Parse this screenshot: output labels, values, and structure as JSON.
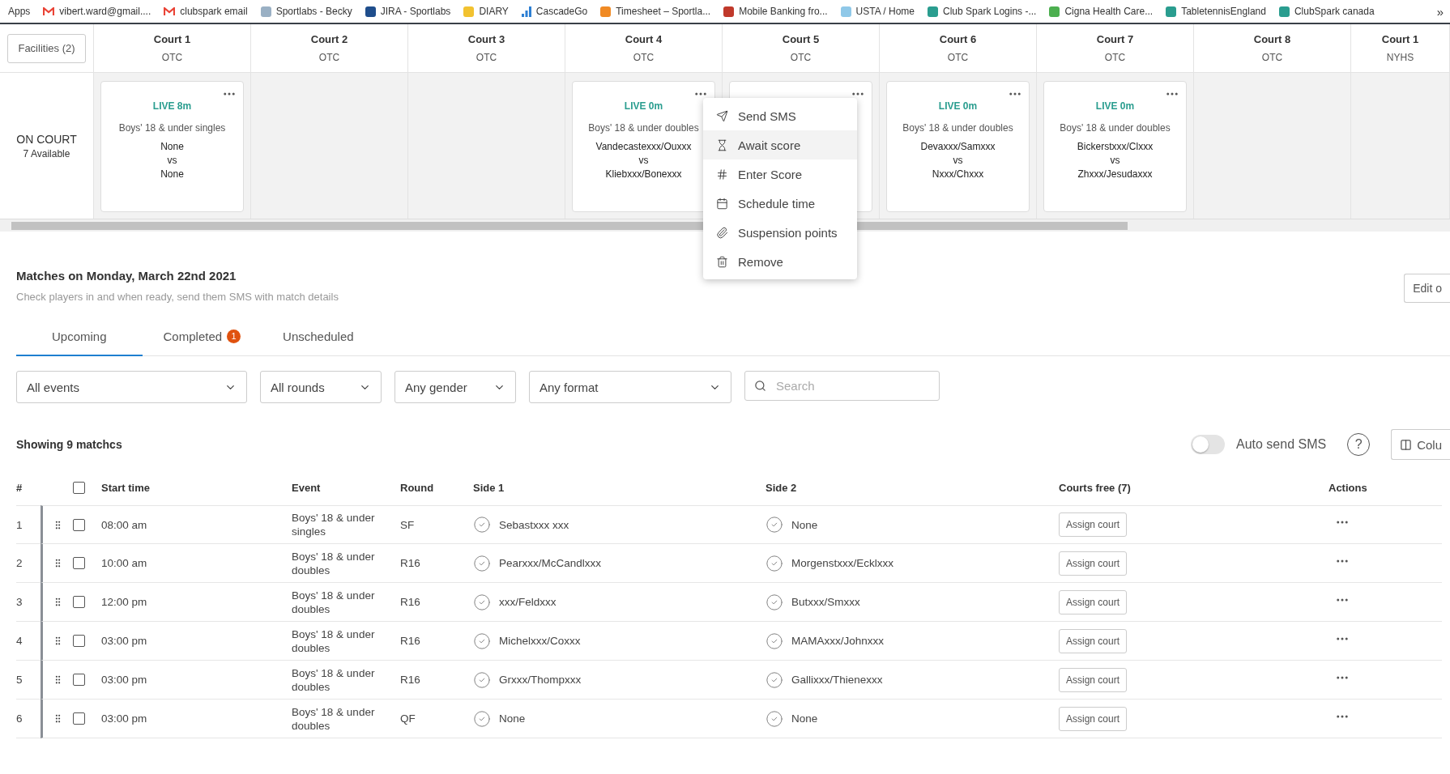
{
  "bookmarks": [
    {
      "label": "Apps",
      "kind": "apps"
    },
    {
      "label": "vibert.ward@gmail....",
      "kind": "mail",
      "color": "#ea4335"
    },
    {
      "label": "clubspark email",
      "kind": "mail",
      "color": "#ea4335"
    },
    {
      "label": "Sportlabs - Becky",
      "kind": "site",
      "color": "#9ab0c4"
    },
    {
      "label": "JIRA - Sportlabs",
      "kind": "site",
      "color": "#1f4e8c"
    },
    {
      "label": "DIARY",
      "kind": "site",
      "color": "#f2c230"
    },
    {
      "label": "CascadeGo",
      "kind": "bars",
      "color": "#2d7fd3"
    },
    {
      "label": "Timesheet – Sportla...",
      "kind": "site",
      "color": "#f08a24"
    },
    {
      "label": "Mobile Banking fro...",
      "kind": "site",
      "color": "#c0392b"
    },
    {
      "label": "USTA / Home",
      "kind": "site",
      "color": "#8fc8e8"
    },
    {
      "label": "Club Spark Logins -...",
      "kind": "site",
      "color": "#2a9d8f"
    },
    {
      "label": "Cigna Health Care...",
      "kind": "site",
      "color": "#4caf50"
    },
    {
      "label": "TabletennisEngland",
      "kind": "site",
      "color": "#2a9d8f"
    },
    {
      "label": "ClubSpark canada",
      "kind": "site",
      "color": "#2a9d8f"
    }
  ],
  "bookmarks_overflow": "»",
  "facilities_button": "Facilities (2)",
  "on_court": {
    "title": "ON COURT",
    "available": "7 Available"
  },
  "courts": [
    {
      "name": "Court 1",
      "venue": "OTC",
      "card": {
        "kind": "match",
        "live": "LIVE 8m",
        "event": "Boys' 18 & under singles",
        "side1": "None",
        "vs": "vs",
        "side2": "None"
      }
    },
    {
      "name": "Court 2",
      "venue": "OTC"
    },
    {
      "name": "Court 3",
      "venue": "OTC"
    },
    {
      "name": "Court 4",
      "venue": "OTC",
      "card": {
        "kind": "match",
        "live": "LIVE 0m",
        "event": "Boys' 18 & under doubles",
        "side1": "Vandecastexxx/Ouxxx",
        "vs": "vs",
        "side2": "Kliebxxx/Bonexxx"
      }
    },
    {
      "name": "Court 5",
      "venue": "OTC",
      "card": {
        "kind": "covered"
      }
    },
    {
      "name": "Court 6",
      "venue": "OTC",
      "card": {
        "kind": "match",
        "live": "LIVE 0m",
        "event": "Boys' 18 & under doubles",
        "side1": "Devaxxx/Samxxx",
        "vs": "vs",
        "side2": "Nxxx/Chxxx"
      }
    },
    {
      "name": "Court 7",
      "venue": "OTC",
      "card": {
        "kind": "match",
        "live": "LIVE 0m",
        "event": "Boys' 18 & under doubles",
        "side1": "Bickerstxxx/Clxxx",
        "vs": "vs",
        "side2": "Zhxxx/Jesudaxxx"
      }
    },
    {
      "name": "Court 8",
      "venue": "OTC"
    },
    {
      "name": "Court 1",
      "venue": "NYHS"
    }
  ],
  "context_menu": [
    {
      "label": "Send SMS",
      "kind": "sms",
      "highlighted": false
    },
    {
      "label": "Await score",
      "kind": "await",
      "highlighted": true
    },
    {
      "label": "Enter Score",
      "kind": "score",
      "highlighted": false
    },
    {
      "label": "Schedule time",
      "kind": "schedule",
      "highlighted": false
    },
    {
      "label": "Suspension points",
      "kind": "suspend",
      "highlighted": false
    },
    {
      "label": "Remove",
      "kind": "remove",
      "highlighted": false
    }
  ],
  "section": {
    "title": "Matches on Monday, March 22nd 2021",
    "subtitle": "Check players in and when ready, send them SMS with match details",
    "edit_button": "Edit o"
  },
  "tabs": [
    {
      "label": "Upcoming",
      "selected": true
    },
    {
      "label": "Completed",
      "selected": false,
      "badge": "1"
    },
    {
      "label": "Unscheduled",
      "selected": false
    }
  ],
  "filters": [
    {
      "value": "All events"
    },
    {
      "value": "All rounds"
    },
    {
      "value": "Any gender"
    },
    {
      "value": "Any format"
    }
  ],
  "search": {
    "placeholder": "Search"
  },
  "summary": "Showing 9 matchcs",
  "auto_send": {
    "label": "Auto send SMS",
    "on": false
  },
  "help": "?",
  "columns_button": "Colu",
  "table": {
    "columns": [
      "#",
      "Start time",
      "Event",
      "Round",
      "Side 1",
      "Side 2",
      "Courts free (7)",
      "Actions"
    ],
    "header_checked": false,
    "rows": [
      {
        "num": "1",
        "checked": false,
        "time": "08:00 am",
        "event": "Boys' 18 & under singles",
        "round": "SF",
        "side1": "Sebastxxx xxx",
        "side2": "None",
        "action": "Assign court"
      },
      {
        "num": "2",
        "checked": false,
        "time": "10:00 am",
        "event": "Boys' 18 & under doubles",
        "round": "R16",
        "side1": "Pearxxx/McCandlxxx",
        "side2": "Morgenstxxx/Ecklxxx",
        "action": "Assign court"
      },
      {
        "num": "3",
        "checked": false,
        "time": "12:00 pm",
        "event": "Boys' 18 & under doubles",
        "round": "R16",
        "side1": "xxx/Feldxxx",
        "side2": "Butxxx/Smxxx",
        "action": "Assign court"
      },
      {
        "num": "4",
        "checked": false,
        "time": "03:00 pm",
        "event": "Boys' 18 & under doubles",
        "round": "R16",
        "side1": "Michelxxx/Coxxx",
        "side2": "MAMAxxx/Johnxxx",
        "action": "Assign court"
      },
      {
        "num": "5",
        "checked": false,
        "time": "03:00 pm",
        "event": "Boys' 18 & under doubles",
        "round": "R16",
        "side1": "Grxxx/Thompxxx",
        "side2": "Gallixxx/Thienexxx",
        "action": "Assign court"
      },
      {
        "num": "6",
        "checked": false,
        "time": "03:00 pm",
        "event": "Boys' 18 & under doubles",
        "round": "QF",
        "side1": "None",
        "side2": "None",
        "action": "Assign court"
      }
    ]
  }
}
